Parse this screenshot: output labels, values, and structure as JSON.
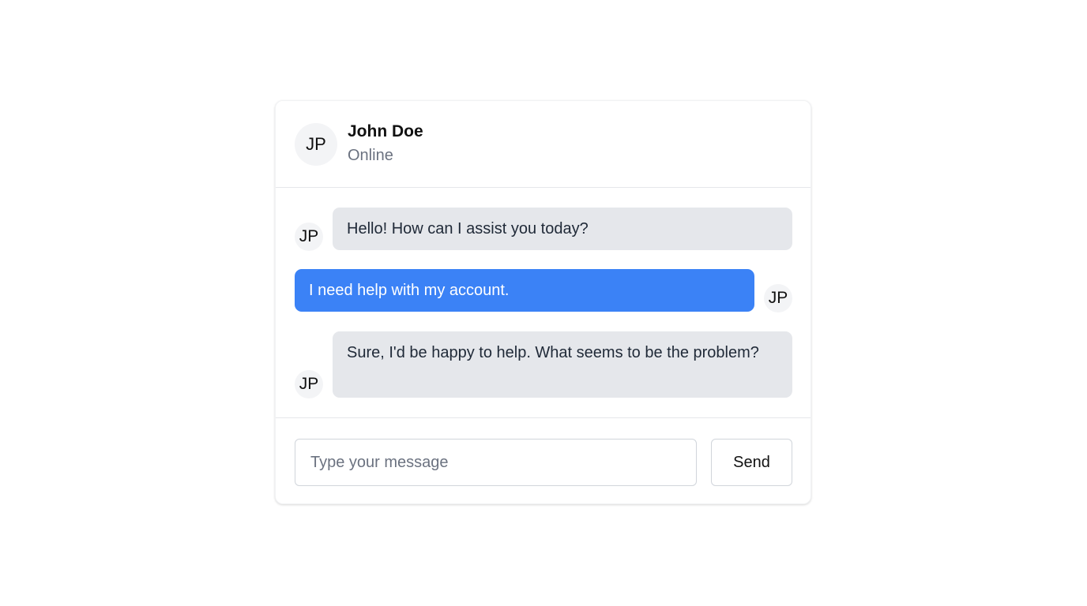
{
  "header": {
    "avatar_initials": "JP",
    "contact_name": "John Doe",
    "status": "Online"
  },
  "messages": [
    {
      "direction": "incoming",
      "avatar_initials": "JP",
      "text": "Hello! How can I assist you today?"
    },
    {
      "direction": "outgoing",
      "avatar_initials": "JP",
      "text": "I need help with my account."
    },
    {
      "direction": "incoming",
      "avatar_initials": "JP",
      "text": "Sure, I'd be happy to help. What seems to be the problem?"
    }
  ],
  "composer": {
    "placeholder": "Type your message",
    "value": "",
    "send_label": "Send"
  },
  "colors": {
    "outgoing_bubble": "#3b82f6",
    "incoming_bubble": "#e5e7eb",
    "avatar_background": "#f3f4f6",
    "status_text": "#6b7280"
  }
}
